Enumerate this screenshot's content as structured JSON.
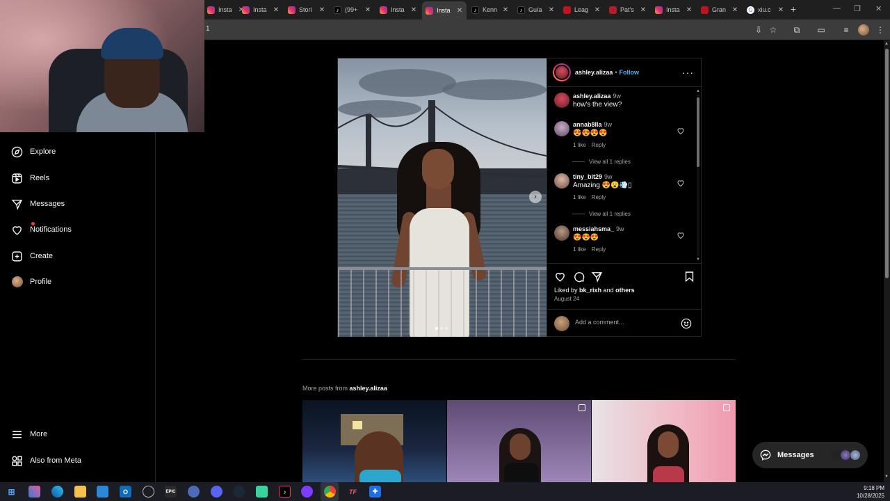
{
  "browser": {
    "tabs": [
      {
        "title": "Insta",
        "icon": "instagram-icon"
      },
      {
        "title": "Insta",
        "icon": "instagram-icon"
      },
      {
        "title": "Stori",
        "icon": "instagram-icon"
      },
      {
        "title": "(99+",
        "icon": "tiktok-icon"
      },
      {
        "title": "Insta",
        "icon": "instagram-icon"
      },
      {
        "title": "Insta",
        "icon": "instagram-icon",
        "active": true
      },
      {
        "title": "Kenn",
        "icon": "tiktok-icon"
      },
      {
        "title": "Guía",
        "icon": "tiktok-icon"
      },
      {
        "title": "Leag",
        "icon": "league-icon"
      },
      {
        "title": "Pat's",
        "icon": "patreon-icon"
      },
      {
        "title": "Insta",
        "icon": "instagram-icon"
      },
      {
        "title": "Gran",
        "icon": "league-icon"
      },
      {
        "title": "xiu.c",
        "icon": "google-icon"
      }
    ],
    "new_tab": "+",
    "url_fragment": "1"
  },
  "sidebar": {
    "items": [
      {
        "label": "Explore",
        "icon": "compass-icon"
      },
      {
        "label": "Reels",
        "icon": "reels-icon"
      },
      {
        "label": "Messages",
        "icon": "send-icon"
      },
      {
        "label": "Notifications",
        "icon": "heart-icon"
      },
      {
        "label": "Create",
        "icon": "plus-square-icon"
      },
      {
        "label": "Profile",
        "icon": "avatar"
      },
      {
        "label": "More",
        "icon": "menu-icon"
      },
      {
        "label": "Also from Meta",
        "icon": "meta-grid-icon"
      }
    ]
  },
  "post": {
    "username": "ashley.alizaa",
    "separator": "•",
    "follow_label": "Follow",
    "more_label": "···",
    "liked_prefix": "Liked by",
    "liked_user": "bk_rixh",
    "liked_and": "and",
    "liked_others": "others",
    "date": "August 24",
    "comment_placeholder": "Add a comment...",
    "comments": [
      {
        "user": "ashley.alizaa",
        "time": "9w",
        "text": "how's the view?",
        "avatar_color": "#b32b3c"
      },
      {
        "user": "annab8lla",
        "time": "9w",
        "text": "😍😍😍😍",
        "likes": "1 like",
        "reply": "Reply",
        "view_replies": "View all 1 replies",
        "avatar_color": "#8a6a8a"
      },
      {
        "user": "tiny_bit29",
        "time": "9w",
        "text": "Amazing 😍😮💨▯",
        "likes": "1 like",
        "reply": "Reply",
        "view_replies": "View all 1 replies",
        "avatar_color": "#a47a6a"
      },
      {
        "user": "messiahsma_",
        "time": "9w",
        "text": "😍😍😍",
        "likes": "1 like",
        "reply": "Reply",
        "avatar_color": "#7a5a4a"
      }
    ]
  },
  "more_posts": {
    "prefix": "More posts from",
    "user": "ashley.alizaa"
  },
  "messages_pill": {
    "label": "Messages"
  },
  "taskbar": {
    "time": "9:18 PM",
    "date": "10/28/2025",
    "apps": [
      "windows-icon",
      "copilot-icon",
      "edge-icon",
      "file-explorer-icon",
      "store-icon",
      "outlook-icon",
      "xbox-icon",
      "epic-icon",
      "app-icon",
      "discord-icon",
      "steam-icon",
      "app-icon",
      "tiktok-icon",
      "app-icon",
      "chrome-icon",
      "tf-icon",
      "app-icon"
    ],
    "epic_label": "EPIC",
    "tf_label": "TF"
  },
  "colors": {
    "accent_blue": "#4cb5f9",
    "notification_red": "#ff3040",
    "background": "#000000"
  }
}
